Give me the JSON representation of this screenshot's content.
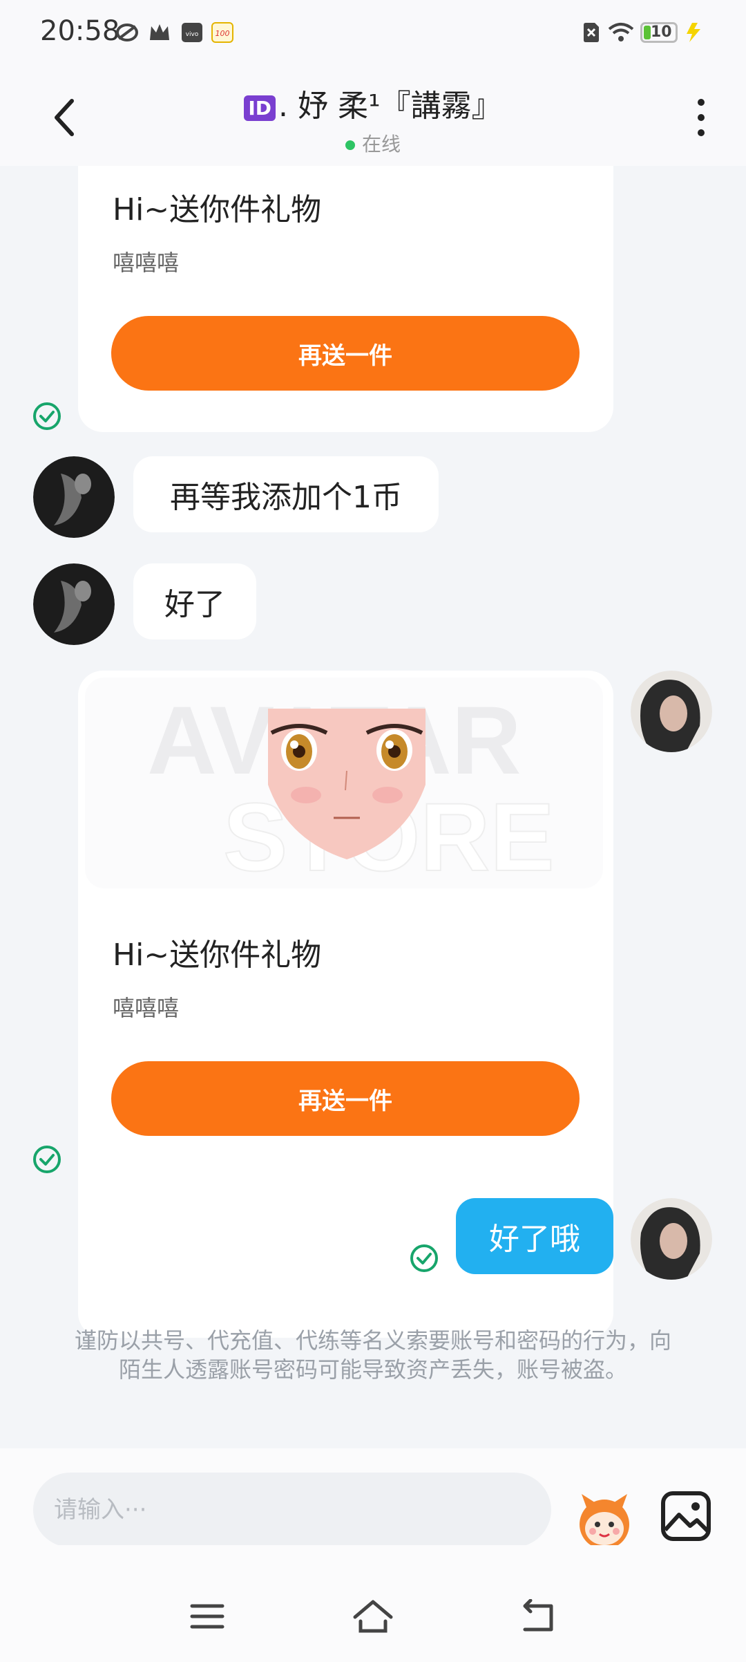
{
  "status_bar": {
    "time": "20:58",
    "battery": "10",
    "icons": [
      "sync-icon",
      "crown-icon",
      "vivo-icon",
      "score-100-icon",
      "sim-off-icon",
      "wifi-icon",
      "battery-icon",
      "charging-icon"
    ]
  },
  "header": {
    "title_badge": "ID",
    "title_text": ". 妤 柔¹『講霧』",
    "status": "在线",
    "online_color": "#2ec464"
  },
  "messages": {
    "gift_1": {
      "title": "Hi~送你件礼物",
      "subtitle": "嘻嘻嘻",
      "button": "再送一件"
    },
    "bubble_1": "再等我添加个1币",
    "bubble_2": "好了",
    "gift_2": {
      "image_watermark_1": "AVATAR",
      "image_watermark_2": "STORE",
      "title": "Hi~送你件礼物",
      "subtitle": "嘻嘻嘻",
      "button": "再送一件"
    },
    "bubble_3": "好了哦"
  },
  "warning": "谨防以共号、代充值、代练等名义索要账号和密码的行为，向陌生人透露账号密码可能导致资产丢失，账号被盗。",
  "input": {
    "placeholder": "请输入···"
  },
  "colors": {
    "accent_orange": "#fb7414",
    "my_bubble": "#22b0f0",
    "check_green": "#17a56b"
  }
}
